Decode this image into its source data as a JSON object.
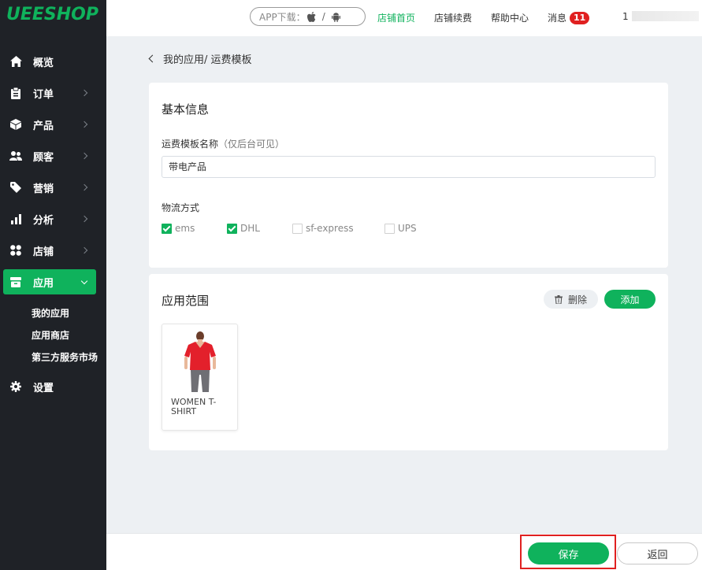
{
  "brand": {
    "logo_text": "UEESHOP",
    "accent": "#0fb25c"
  },
  "sidebar": {
    "items": [
      {
        "label": "概览",
        "icon": "home-icon"
      },
      {
        "label": "订单",
        "icon": "clipboard-icon"
      },
      {
        "label": "产品",
        "icon": "box-icon"
      },
      {
        "label": "顾客",
        "icon": "users-icon"
      },
      {
        "label": "营销",
        "icon": "tag-icon"
      },
      {
        "label": "分析",
        "icon": "bar-chart-icon"
      },
      {
        "label": "店铺",
        "icon": "grid-icon"
      },
      {
        "label": "应用",
        "icon": "app-icon"
      },
      {
        "label": "设置",
        "icon": "gear-icon"
      }
    ],
    "subitems": [
      "我的应用",
      "应用商店",
      "第三方服务市场"
    ]
  },
  "topbar": {
    "app_download": "APP下载：",
    "store_home": "店铺首页",
    "store_renew": "店铺续费",
    "help_center": "帮助中心",
    "messages": "消息",
    "message_count": "11",
    "user_prefix": "1"
  },
  "breadcrumb": "我的应用/ 运费模板",
  "basic_info": {
    "title": "基本信息",
    "name_label": "运费模板名称",
    "name_hint": "（仅后台可见）",
    "name_value": "带电产品",
    "logistics_label": "物流方式",
    "logistics_options": [
      {
        "label": "ems",
        "checked": true
      },
      {
        "label": "DHL",
        "checked": true
      },
      {
        "label": "sf-express",
        "checked": false
      },
      {
        "label": "UPS",
        "checked": false
      }
    ]
  },
  "scope": {
    "title": "应用范围",
    "delete_label": "删除",
    "add_label": "添加",
    "products": [
      {
        "name": "WOMEN T-SHIRT"
      }
    ]
  },
  "footer": {
    "save_label": "保存",
    "back_label": "返回"
  }
}
